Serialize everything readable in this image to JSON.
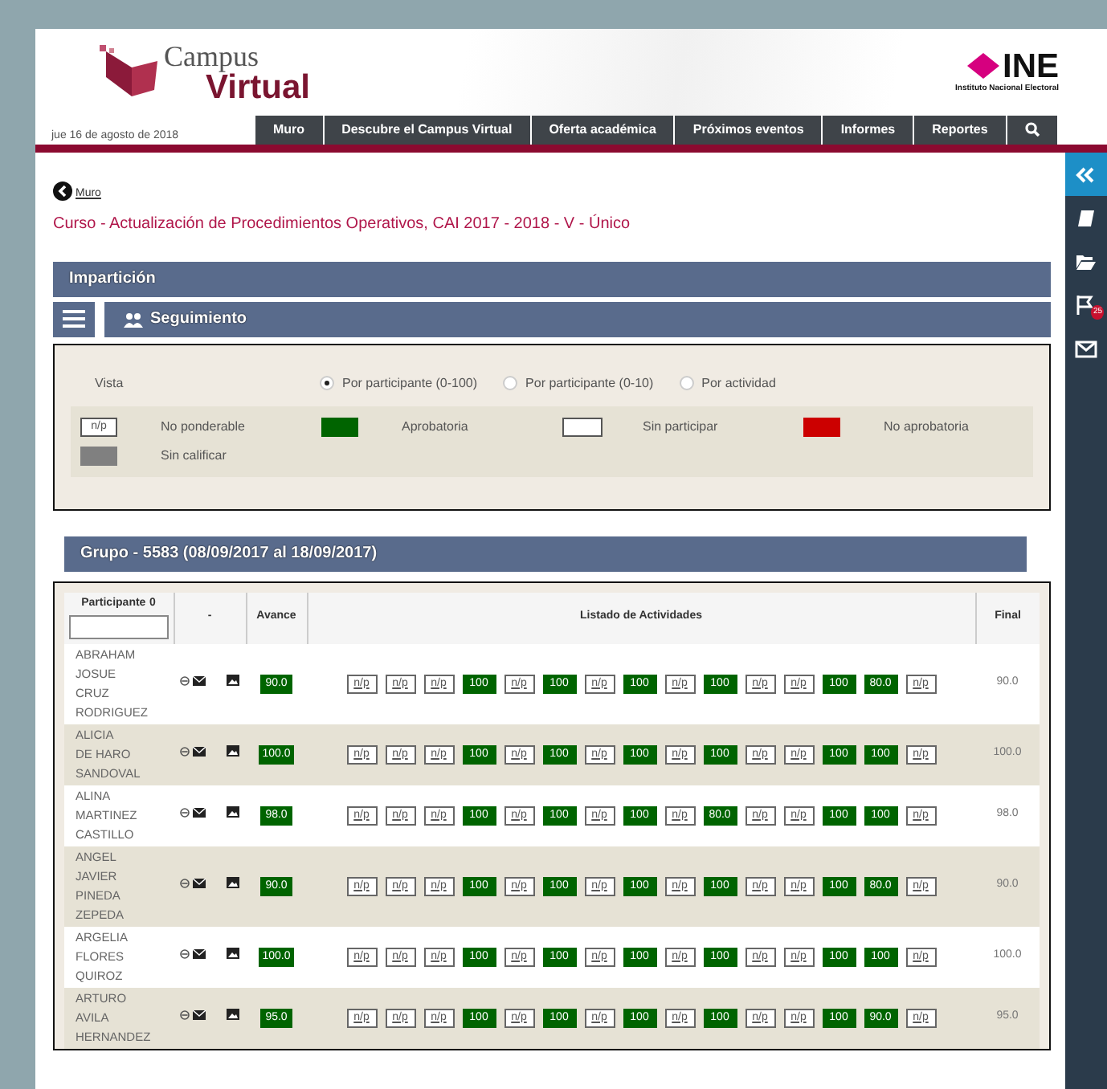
{
  "header": {
    "logo_top": "Campus",
    "logo_bottom": "Virtual",
    "org_short": "INE",
    "org_name": "Instituto Nacional Electoral",
    "date": "jue 16 de agosto de 2018"
  },
  "nav": [
    "Muro",
    "Descubre el Campus Virtual",
    "Oferta académica",
    "Próximos eventos",
    "Informes",
    "Reportes"
  ],
  "sidebar": [
    {
      "kind": "collapse",
      "selected": true
    },
    {
      "kind": "book",
      "selected": false
    },
    {
      "kind": "folder",
      "selected": false
    },
    {
      "kind": "flag",
      "selected": false,
      "badge": "25"
    },
    {
      "kind": "mail",
      "selected": false
    }
  ],
  "back_link": "Muro",
  "course_title": "Curso - Actualización de Procedimientos Operativos, CAI 2017 - 2018 - V - Único",
  "section_title": "Impartición",
  "subsection_title": "Seguimiento",
  "view": {
    "label": "Vista",
    "options": [
      {
        "label": "Por participante (0-100)",
        "selected": true
      },
      {
        "label": "Por participante (0-10)",
        "selected": false
      },
      {
        "label": "Por actividad",
        "selected": false
      }
    ]
  },
  "legend": [
    {
      "kind": "np",
      "sample": "n/p",
      "label": "No ponderable"
    },
    {
      "kind": "fill",
      "color": "#006400",
      "label": "Aprobatoria"
    },
    {
      "kind": "outline",
      "label": "Sin participar"
    },
    {
      "kind": "fill",
      "color": "#cc0000",
      "label": "No aprobatoria"
    },
    {
      "kind": "fill",
      "color": "#808080",
      "label": "Sin calificar"
    }
  ],
  "group_title": "Grupo - 5583 (08/09/2017 al 18/09/2017)",
  "table": {
    "columns": [
      "Participante",
      "-",
      "Avance",
      "Listado de Actividades",
      "Final"
    ],
    "sort_mark": "0",
    "rows": [
      {
        "name_lines": [
          "ABRAHAM",
          "JOSUE",
          "CRUZ",
          "RODRIGUEZ"
        ],
        "avance": "90.0",
        "final": "90.0",
        "activities": [
          "n/p",
          "n/p",
          "n/p",
          "100",
          "n/p",
          "100",
          "n/p",
          "100",
          "n/p",
          "100",
          "n/p",
          "n/p",
          "100",
          "80.0",
          "n/p"
        ]
      },
      {
        "name_lines": [
          "ALICIA",
          "DE HARO",
          "SANDOVAL"
        ],
        "avance": "100.0",
        "final": "100.0",
        "activities": [
          "n/p",
          "n/p",
          "n/p",
          "100",
          "n/p",
          "100",
          "n/p",
          "100",
          "n/p",
          "100",
          "n/p",
          "n/p",
          "100",
          "100",
          "n/p"
        ]
      },
      {
        "name_lines": [
          "ALINA",
          "MARTINEZ",
          "CASTILLO"
        ],
        "avance": "98.0",
        "final": "98.0",
        "activities": [
          "n/p",
          "n/p",
          "n/p",
          "100",
          "n/p",
          "100",
          "n/p",
          "100",
          "n/p",
          "80.0",
          "n/p",
          "n/p",
          "100",
          "100",
          "n/p"
        ]
      },
      {
        "name_lines": [
          "ANGEL",
          "JAVIER",
          "PINEDA",
          "ZEPEDA"
        ],
        "avance": "90.0",
        "final": "90.0",
        "activities": [
          "n/p",
          "n/p",
          "n/p",
          "100",
          "n/p",
          "100",
          "n/p",
          "100",
          "n/p",
          "100",
          "n/p",
          "n/p",
          "100",
          "80.0",
          "n/p"
        ]
      },
      {
        "name_lines": [
          "ARGELIA",
          "FLORES",
          "QUIROZ"
        ],
        "avance": "100.0",
        "final": "100.0",
        "activities": [
          "n/p",
          "n/p",
          "n/p",
          "100",
          "n/p",
          "100",
          "n/p",
          "100",
          "n/p",
          "100",
          "n/p",
          "n/p",
          "100",
          "100",
          "n/p"
        ]
      },
      {
        "name_lines": [
          "ARTURO",
          "AVILA",
          "HERNANDEZ"
        ],
        "avance": "95.0",
        "final": "95.0",
        "activities": [
          "n/p",
          "n/p",
          "n/p",
          "100",
          "n/p",
          "100",
          "n/p",
          "100",
          "n/p",
          "100",
          "n/p",
          "n/p",
          "100",
          "90.0",
          "n/p"
        ]
      }
    ]
  }
}
